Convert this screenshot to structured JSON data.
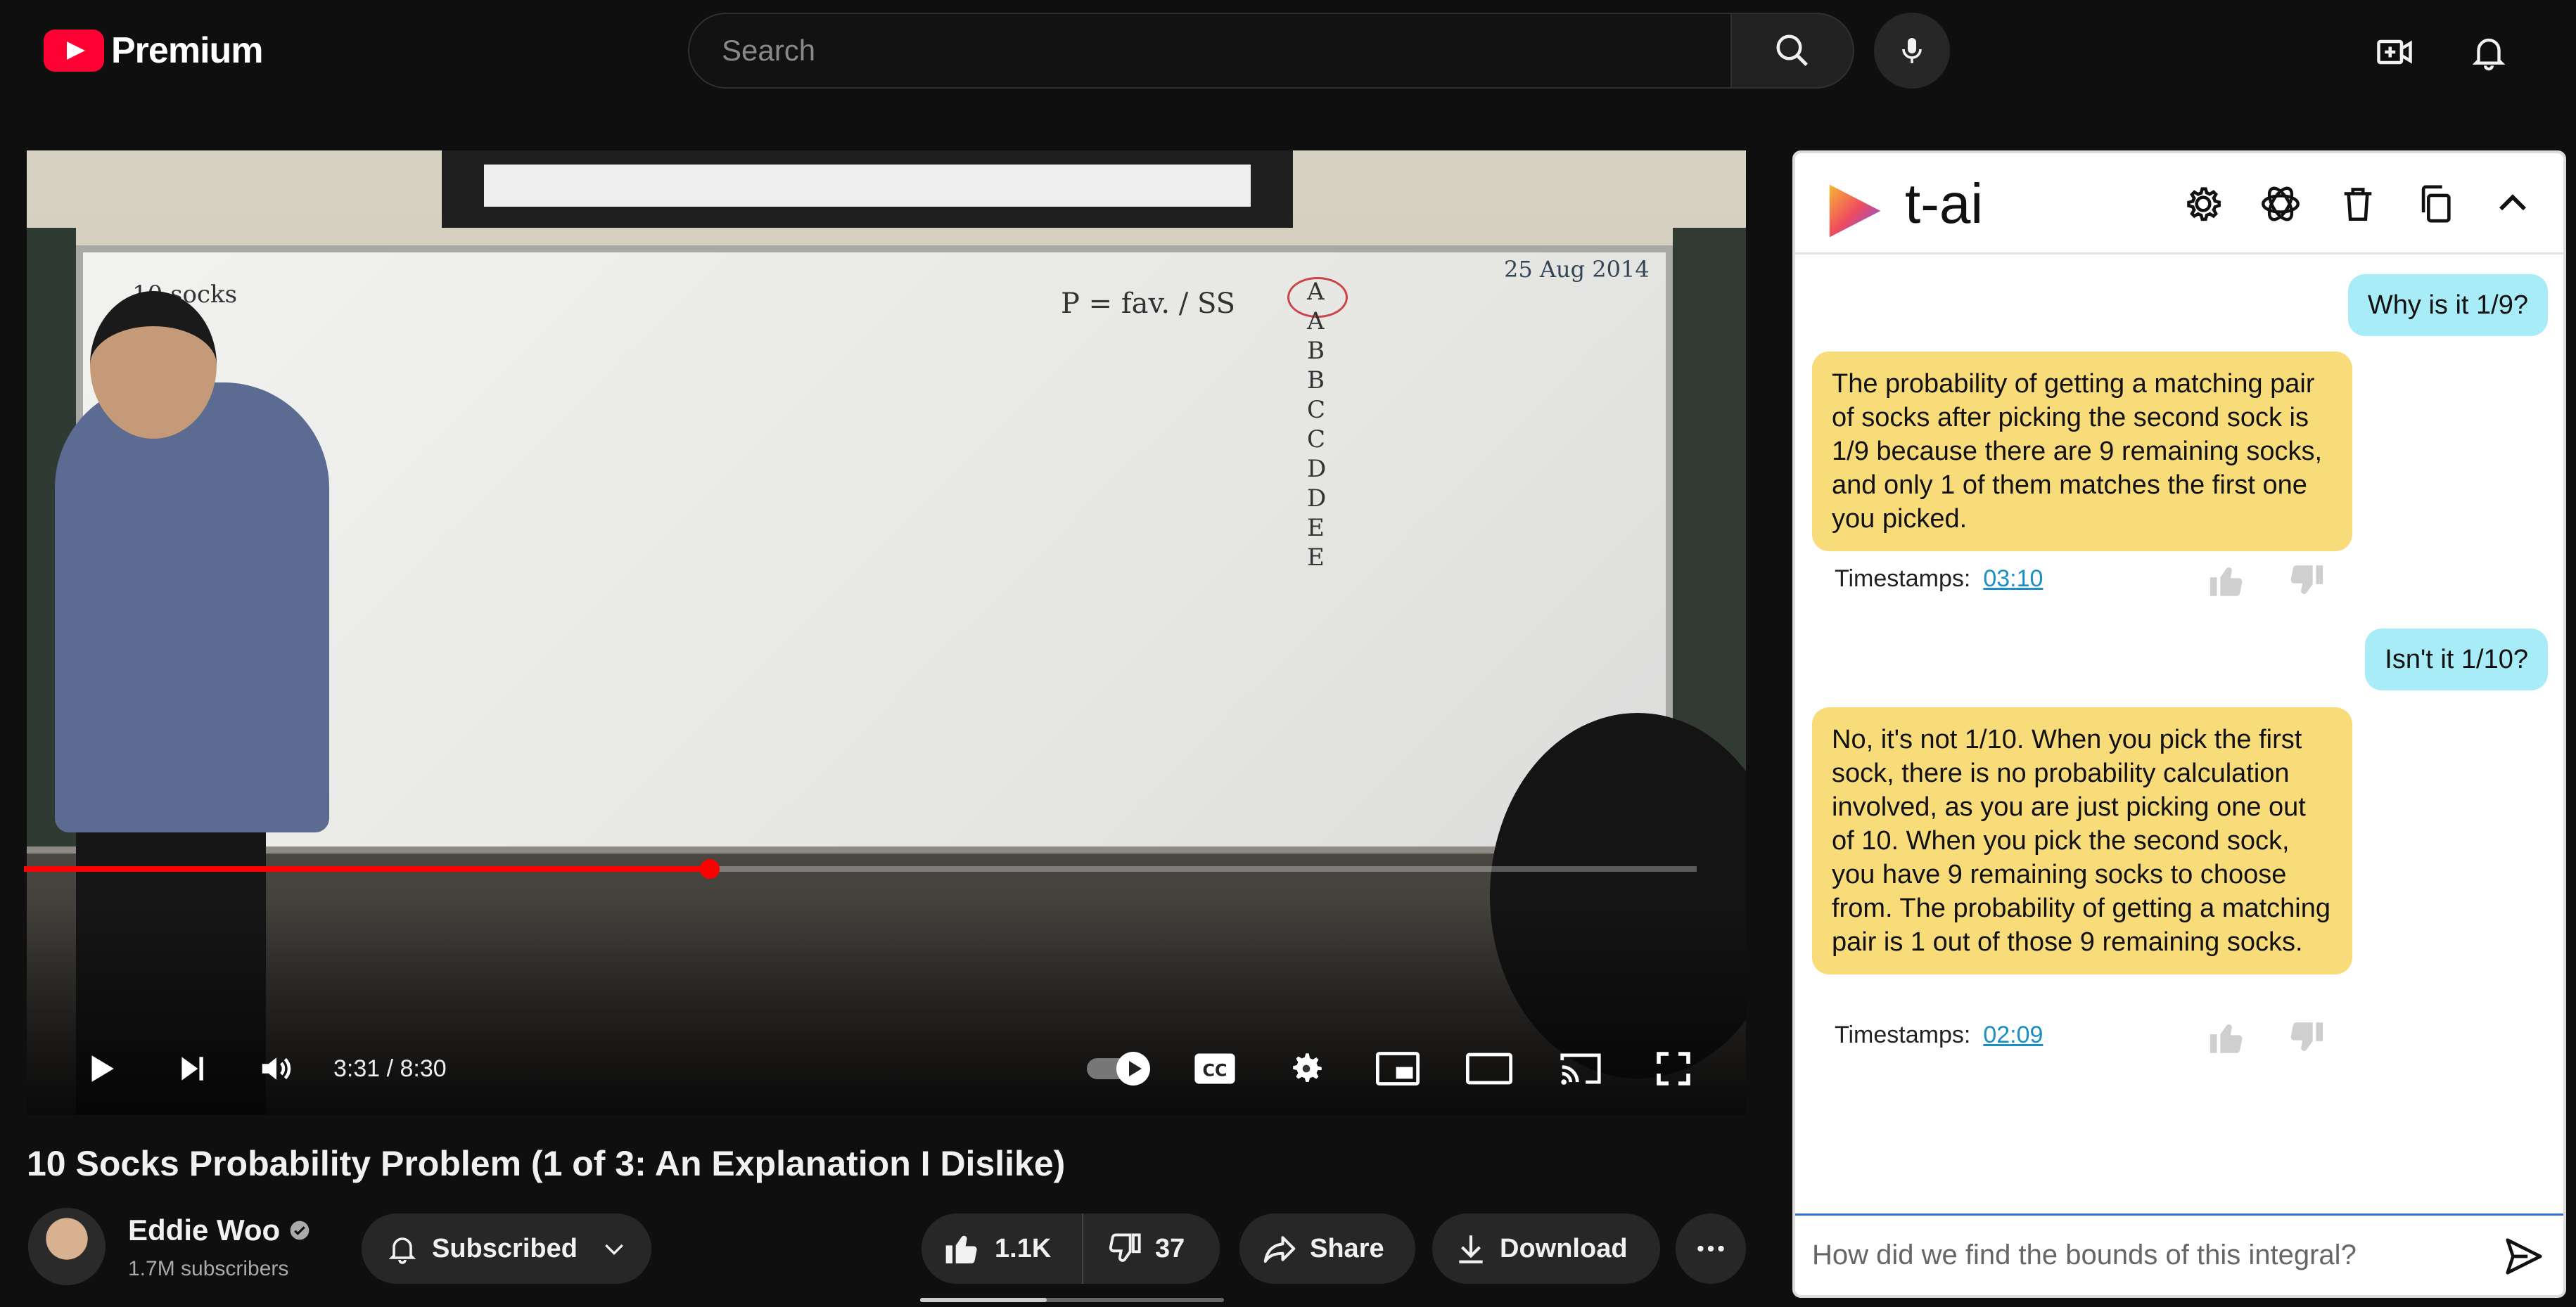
{
  "header": {
    "logo_text": "Premium",
    "search_placeholder": "Search",
    "icons": [
      "youtube-logo-icon",
      "search-icon",
      "mic-icon",
      "create-video-icon",
      "bell-icon"
    ]
  },
  "player": {
    "time": "3:31 / 8:30",
    "progress_fraction": 0.41,
    "board_text": {
      "left": "10 socks",
      "formula": "P = fav. / SS",
      "date": "25 Aug 2014",
      "column": [
        "A",
        "A",
        "B",
        "B",
        "C",
        "C",
        "D",
        "D",
        "E",
        "E"
      ]
    }
  },
  "video": {
    "title": "10 Socks Probability Problem (1 of 3: An Explanation I Dislike)",
    "channel": "Eddie Woo",
    "subscribers": "1.7M subscribers",
    "subscribe_label": "Subscribed",
    "likes": "1.1K",
    "dislikes": "37",
    "share_label": "Share",
    "download_label": "Download"
  },
  "tai": {
    "title": "t-ai",
    "messages": [
      {
        "role": "user",
        "text": "Why is it 1/9?"
      },
      {
        "role": "bot",
        "text": "The probability of getting a matching pair of socks after picking the second sock is 1/9 because there are 9 remaining socks, and only 1 of them matches the first one you picked.",
        "timestamps_label": "Timestamps:",
        "timestamp": "03:10"
      },
      {
        "role": "user",
        "text": "Isn't it 1/10?"
      },
      {
        "role": "bot",
        "text": "No, it's not 1/10. When you pick the first sock, there is no probability calculation involved, as you are just picking one out of 10. When you pick the second sock, you have 9 remaining socks to choose from. The probability of getting a matching pair is 1 out of those 9 remaining socks.",
        "timestamps_label": "Timestamps:",
        "timestamp": "02:09"
      }
    ],
    "input_placeholder": "How did we find the bounds of this integral?"
  },
  "colors": {
    "youtube_red": "#ff0033",
    "progress_red": "#ff0000",
    "user_bubble": "#a7ecf6",
    "bot_bubble": "#f9dc7a",
    "link_blue": "#1a8fc4",
    "input_focus": "#2f6fd6"
  }
}
